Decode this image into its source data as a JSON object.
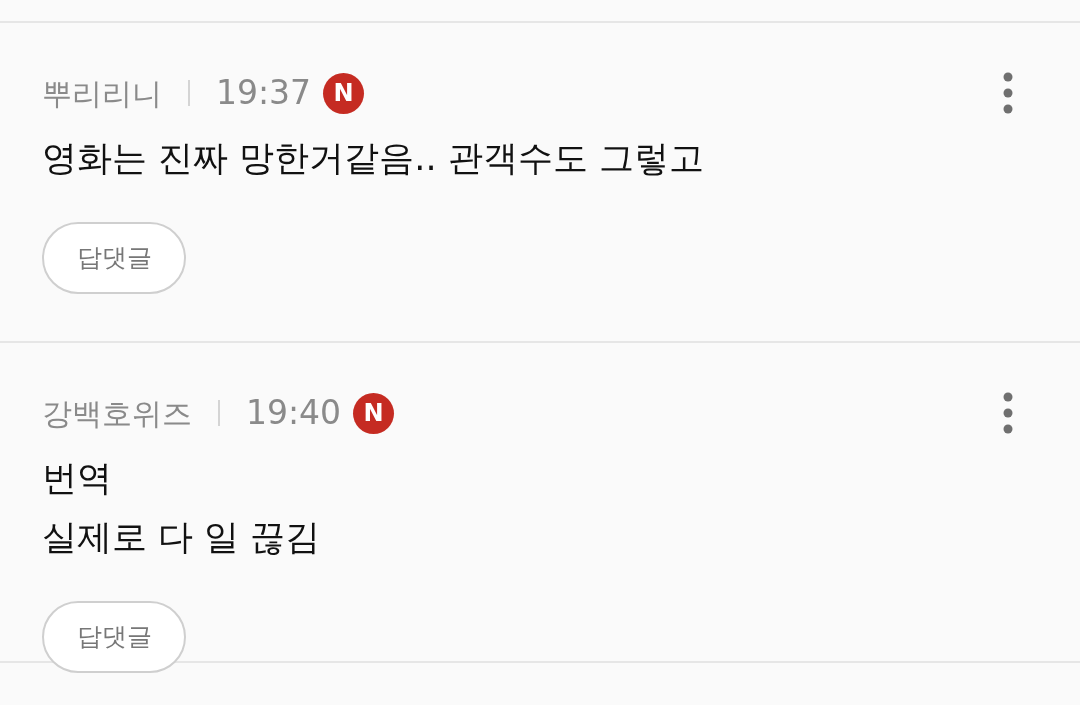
{
  "comments": [
    {
      "author": "뿌리리니",
      "time": "19:37",
      "badge": "N",
      "text": "영화는 진짜 망한거같음.. 관객수도 그렇고",
      "reply_button": "답댓글"
    },
    {
      "author": "강백호위즈",
      "time": "19:40",
      "badge": "N",
      "text": "번역\n실제로 다 일 끊김",
      "reply_button": "답댓글"
    }
  ]
}
